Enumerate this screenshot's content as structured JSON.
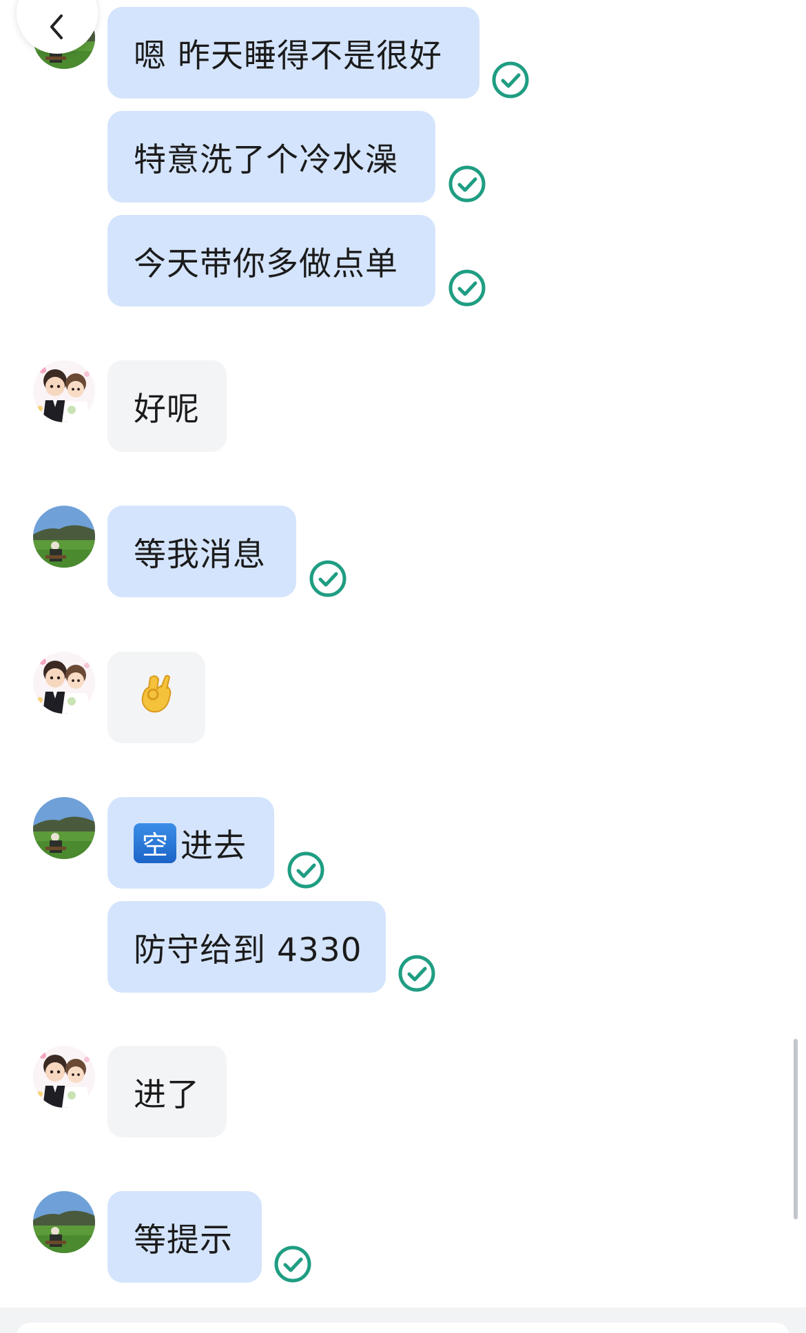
{
  "messages": [
    {
      "text": "嗯 昨天睡得不是很好",
      "sender": "me"
    },
    {
      "text": "特意洗了个冷水澡",
      "sender": "me"
    },
    {
      "text": "今天带你多做点单",
      "sender": "me"
    },
    {
      "text": "好呢",
      "sender": "other"
    },
    {
      "text": "等我消息",
      "sender": "me"
    },
    {
      "text": "👌",
      "sender": "other"
    },
    {
      "icon_text": "空",
      "text": "进去",
      "sender": "me"
    },
    {
      "text": "防守给到 4330",
      "sender": "me"
    },
    {
      "text": "进了",
      "sender": "other"
    },
    {
      "text": "等提示",
      "sender": "me"
    }
  ],
  "icons": {
    "back": "chevron-left-icon",
    "read": "read-check-icon",
    "avatar_me": "landscape-avatar",
    "avatar_other": "cartoon-couple-avatar"
  },
  "colors": {
    "my_bubble": "#d4e4fc",
    "their_bubble": "#f3f4f6",
    "read_check": "#1f9d82",
    "text": "#1b1b1b"
  }
}
